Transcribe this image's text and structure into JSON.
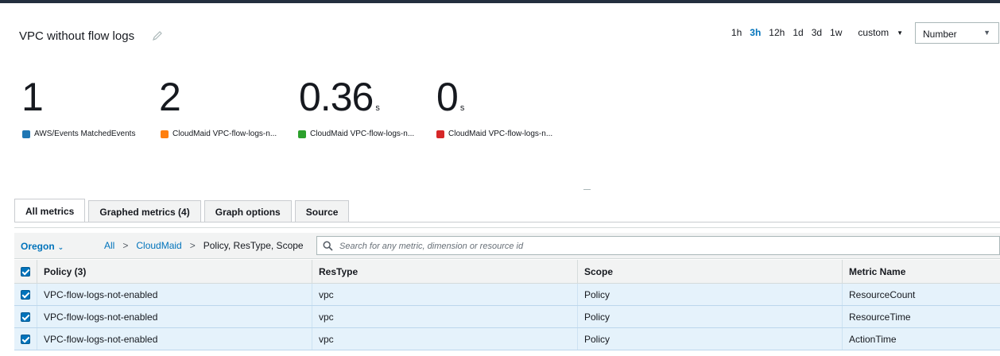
{
  "widget": {
    "title": "VPC without flow logs"
  },
  "time_range": {
    "options": [
      "1h",
      "3h",
      "12h",
      "1d",
      "3d",
      "1w"
    ],
    "active": "3h",
    "custom_label": "custom"
  },
  "view_select": {
    "value": "Number"
  },
  "big_numbers": [
    {
      "value": "1",
      "unit": "",
      "legend": "AWS/Events MatchedEvents",
      "color": "#1f77b4"
    },
    {
      "value": "2",
      "unit": "",
      "legend": "CloudMaid VPC-flow-logs-n...",
      "color": "#ff7f0e"
    },
    {
      "value": "0.36",
      "unit": "s",
      "legend": "CloudMaid VPC-flow-logs-n...",
      "color": "#2ca02c"
    },
    {
      "value": "0",
      "unit": "s",
      "legend": "CloudMaid VPC-flow-logs-n...",
      "color": "#d62728"
    }
  ],
  "tabs": [
    {
      "label": "All metrics",
      "active": true
    },
    {
      "label": "Graphed metrics (4)",
      "active": false
    },
    {
      "label": "Graph options",
      "active": false
    },
    {
      "label": "Source",
      "active": false
    }
  ],
  "filter": {
    "region": "Oregon",
    "breadcrumb": [
      "All",
      "CloudMaid",
      "Policy, ResType, Scope"
    ],
    "search_placeholder": "Search for any metric, dimension or resource id"
  },
  "table": {
    "headers": [
      "Policy (3)",
      "ResType",
      "Scope",
      "Metric Name"
    ],
    "rows": [
      [
        "VPC-flow-logs-not-enabled",
        "vpc",
        "Policy",
        "ResourceCount"
      ],
      [
        "VPC-flow-logs-not-enabled",
        "vpc",
        "Policy",
        "ResourceTime"
      ],
      [
        "VPC-flow-logs-not-enabled",
        "vpc",
        "Policy",
        "ActionTime"
      ]
    ]
  },
  "colors": {
    "accent": "#0073bb",
    "row_selected": "#e5f2fb",
    "header_bg": "#f2f3f3"
  }
}
